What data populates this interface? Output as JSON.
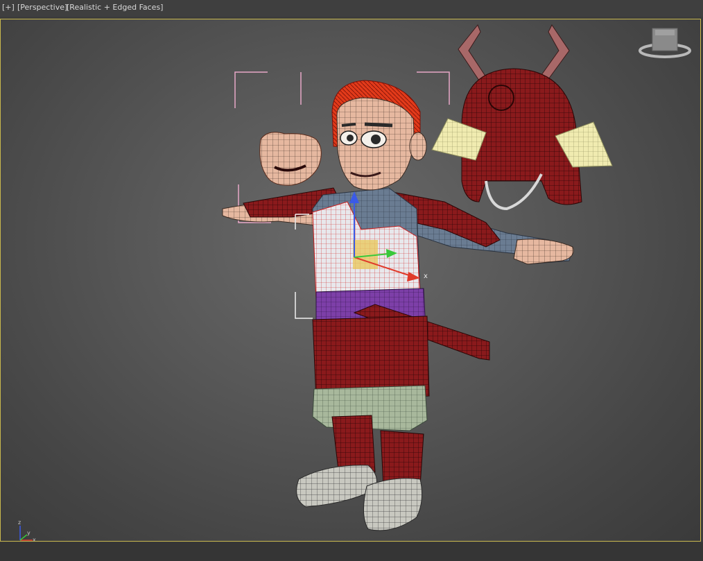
{
  "viewport": {
    "labels": {
      "plus": "[+]",
      "view": "[Perspective]",
      "shading": "[Realistic + Edged Faces]"
    },
    "gizmo_axis_label": "x",
    "axis_tripod": {
      "z": "z",
      "x": "x",
      "y": "y"
    },
    "viewcube_icon": "viewcube-icon"
  },
  "colors": {
    "frame_border": "#c9b84d",
    "selection_bracket": "#e8a8c8",
    "armor_red": "#7a1618",
    "hair": "#e23a1a",
    "skin": "#e6b8a0",
    "white_chestplate": "#f2f2f2",
    "sash_purple": "#7d3fa8",
    "shoulder_pads": "#f0ebb0"
  }
}
